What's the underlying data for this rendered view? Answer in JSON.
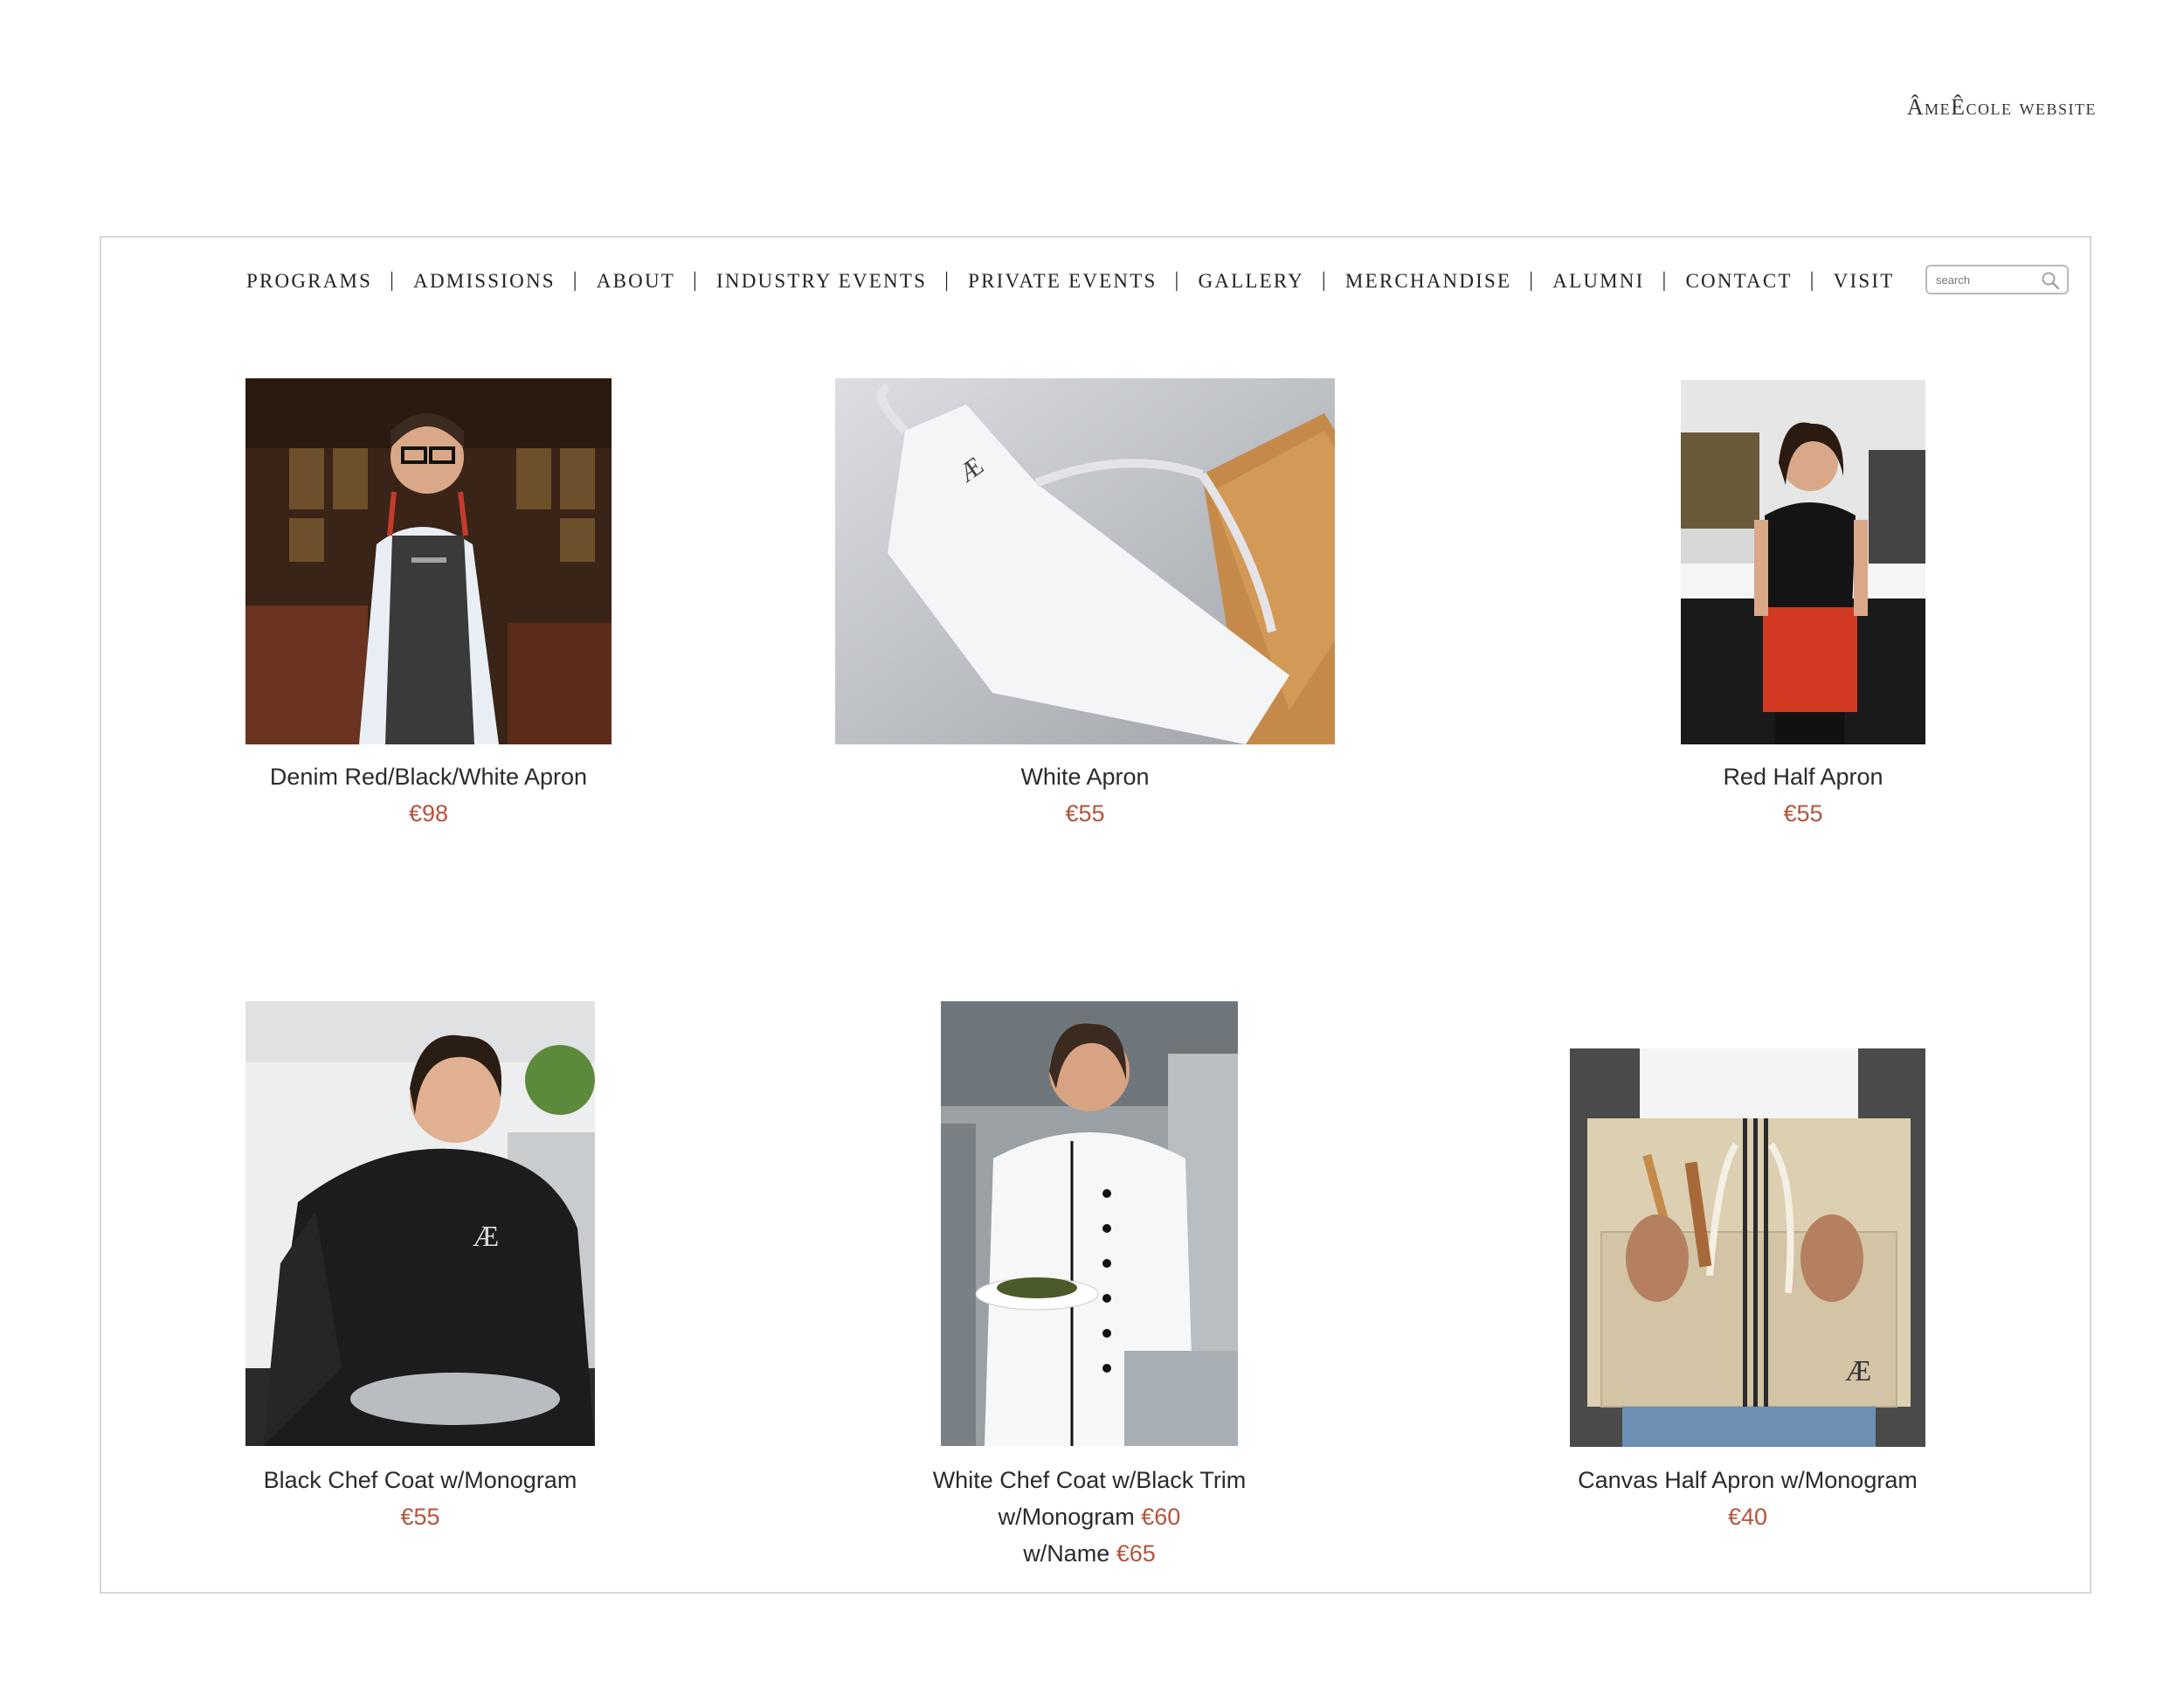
{
  "site": {
    "title": "ÂmeÊcole website"
  },
  "nav": {
    "items": [
      "PROGRAMS",
      "ADMISSIONS",
      "ABOUT",
      "INDUSTRY EVENTS",
      "PRIVATE EVENTS",
      "GALLERY",
      "MERCHANDISE",
      "ALUMNI",
      "CONTACT",
      "VISIT"
    ],
    "separator": "|"
  },
  "search": {
    "placeholder": "search"
  },
  "products": [
    {
      "name": "Denim Red/Black/White Apron",
      "price": "€98"
    },
    {
      "name": "White Apron",
      "price": "€55"
    },
    {
      "name": "Red Half Apron",
      "price": "€55"
    },
    {
      "name": "Black Chef Coat w/Monogram",
      "price": "€55"
    },
    {
      "name": "White Chef Coat w/Black Trim",
      "line2_label": "w/Monogram",
      "price": "€60",
      "line3_label": "w/Name",
      "price2": "€65"
    },
    {
      "name": "Canvas Half Apron w/Monogram",
      "price": "€40"
    }
  ],
  "colors": {
    "price": "#b5533c",
    "frame_border": "#d6d6d6",
    "text": "#222222"
  }
}
